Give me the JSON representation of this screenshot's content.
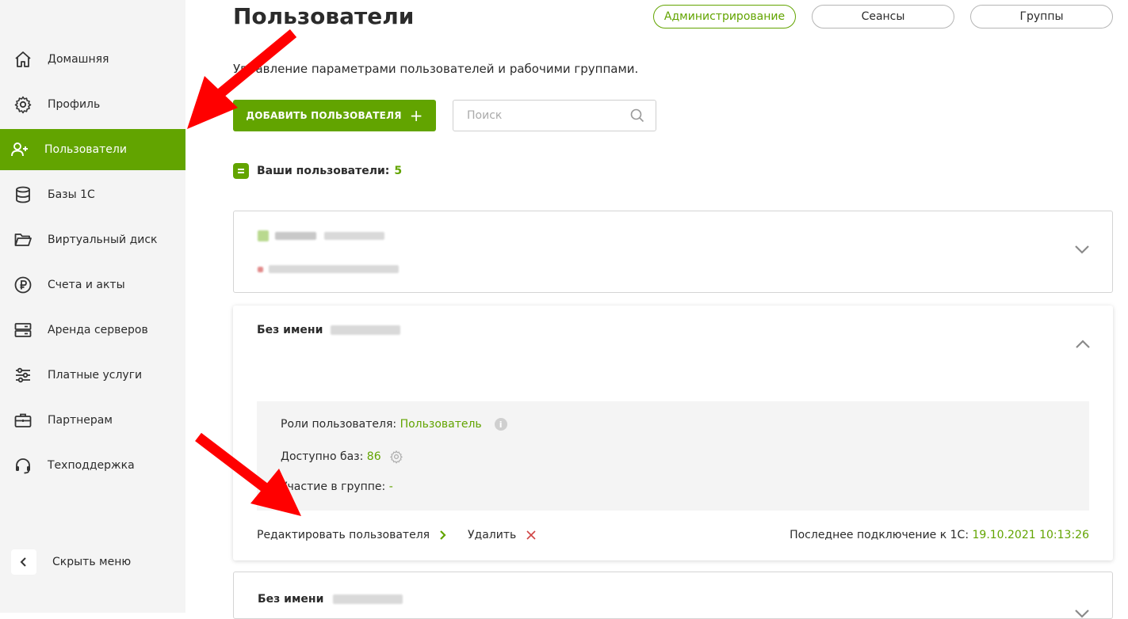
{
  "sidebar": {
    "items": [
      {
        "label": "Домашняя",
        "icon": "home-icon"
      },
      {
        "label": "Профиль",
        "icon": "gear-icon"
      },
      {
        "label": "Пользователи",
        "icon": "add-user-icon",
        "active": true
      },
      {
        "label": "Базы 1С",
        "icon": "database-icon"
      },
      {
        "label": "Виртуальный диск",
        "icon": "folder-icon"
      },
      {
        "label": "Счета и акты",
        "icon": "ruble-icon"
      },
      {
        "label": "Аренда серверов",
        "icon": "server-icon"
      },
      {
        "label": "Платные услуги",
        "icon": "sliders-icon"
      },
      {
        "label": "Партнерам",
        "icon": "briefcase-icon"
      },
      {
        "label": "Техподдержка",
        "icon": "headset-icon"
      }
    ],
    "hide_menu": "Скрыть меню"
  },
  "header": {
    "title": "Пользователи",
    "tabs": [
      {
        "label": "Администрирование",
        "active": true
      },
      {
        "label": "Сеансы"
      },
      {
        "label": "Группы"
      }
    ]
  },
  "main": {
    "subtitle": "Управление параметрами пользователей и рабочими группами.",
    "add_button": "ДОБАВИТЬ ПОЛЬЗОВАТЕЛЯ",
    "search_placeholder": "Поиск",
    "users_label": "Ваши пользователи:",
    "users_count": "5",
    "cards": [
      {
        "expanded": false
      },
      {
        "name": "Без имени",
        "expanded": true,
        "roles_label": "Роли пользователя:",
        "roles_value": "Пользователь",
        "bases_label": "Доступно баз:",
        "bases_value": "86",
        "group_label": "Участие в группе:",
        "group_value": "-",
        "edit_label": "Редактировать пользователя",
        "delete_label": "Удалить",
        "last_conn_label": "Последнее подключение к 1С:",
        "last_conn_value": "19.10.2021 10:13:26"
      },
      {
        "name": "Без имени",
        "expanded": false
      }
    ]
  },
  "colors": {
    "accent": "#62a400",
    "arrow": "#ff0000",
    "delete": "#d04545"
  }
}
